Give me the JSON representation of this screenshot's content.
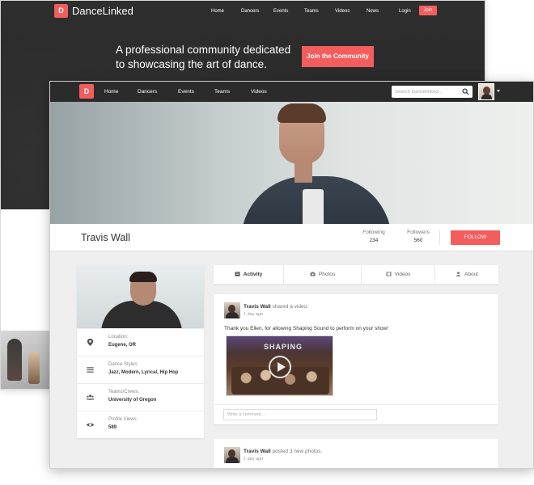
{
  "landing": {
    "logo_text": "D",
    "brand": "DanceLinked",
    "nav": [
      "Home",
      "Dancers",
      "Events",
      "Teams",
      "Videos",
      "News",
      "Login"
    ],
    "join": "Join",
    "tagline_line1": "A professional community dedicated",
    "tagline_line2": "to showcasing the art of dance.",
    "cta": "Join the Community"
  },
  "app": {
    "logo_text": "D",
    "nav": [
      "Home",
      "Dancers",
      "Events",
      "Teams",
      "Videos"
    ],
    "search_placeholder": "Search Dancelinked...",
    "icons": {
      "search": "search-icon",
      "caret": "chevron-down-icon"
    }
  },
  "profile": {
    "name": "Travis Wall",
    "following_label": "Following",
    "following_count": "234",
    "followers_label": "Followers",
    "followers_count": "560",
    "follow_button": "FOLLOW"
  },
  "info": {
    "location_label": "Location:",
    "location_value": "Eugene, OR",
    "styles_label": "Dance Styles:",
    "styles_value": "Jazz, Modern, Lyrical, Hip Hop",
    "teams_label": "Teams/Crews:",
    "teams_value": "University of Oregon",
    "views_label": "Profile Views:",
    "views_value": "589"
  },
  "tabs": [
    "Activity",
    "Photos",
    "Videos",
    "About"
  ],
  "posts": [
    {
      "author": "Travis Wall",
      "action": "shared a video.",
      "time": "1 day ago",
      "text": "Thank you Ellen, for allowing Shaping Sound to perform on your show!",
      "video_mark": "SHAPING",
      "comment_placeholder": "Write a comment..."
    },
    {
      "author": "Travis Wall",
      "action": "posted 3 new photos.",
      "time": "1 day ago"
    }
  ],
  "colors": {
    "accent": "#f45d5d",
    "nav_dark": "#2b2b2b",
    "page_bg": "#efefef"
  }
}
